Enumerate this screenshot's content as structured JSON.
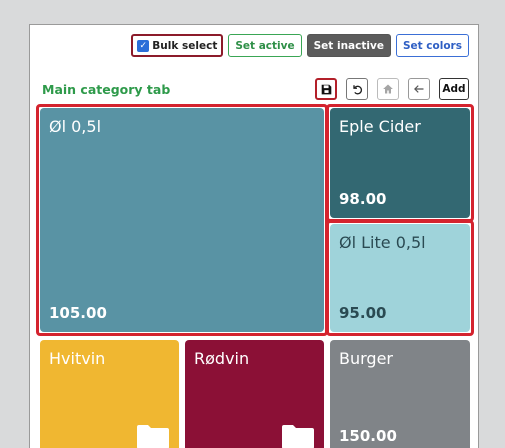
{
  "toolbar": {
    "bulk_select": "Bulk select",
    "set_active": "Set active",
    "set_inactive": "Set inactive",
    "set_colors": "Set colors"
  },
  "tab": {
    "title": "Main category tab",
    "add_label": "Add",
    "icons": [
      "save-icon",
      "undo-icon",
      "home-icon",
      "back-arrow-icon"
    ]
  },
  "tiles": [
    {
      "name": "Øl 0,5l",
      "price": "105.00",
      "color": "#5993a4",
      "selected": true
    },
    {
      "name": "Eple Cider",
      "price": "98.00",
      "color": "#336872",
      "selected": true
    },
    {
      "name": "Øl Lite 0,5l",
      "price": "95.00",
      "color": "#9fd3da",
      "text_color": "#2a4a52",
      "selected": true
    },
    {
      "name": "Hvitvin",
      "color": "#f0b731",
      "type": "folder"
    },
    {
      "name": "Rødvin",
      "color": "#8b1036",
      "type": "folder"
    },
    {
      "name": "Burger",
      "price": "150.00",
      "color": "#808488"
    }
  ],
  "colors": {
    "accent_green": "#2e9a4a",
    "selection_red": "#d4232e"
  }
}
